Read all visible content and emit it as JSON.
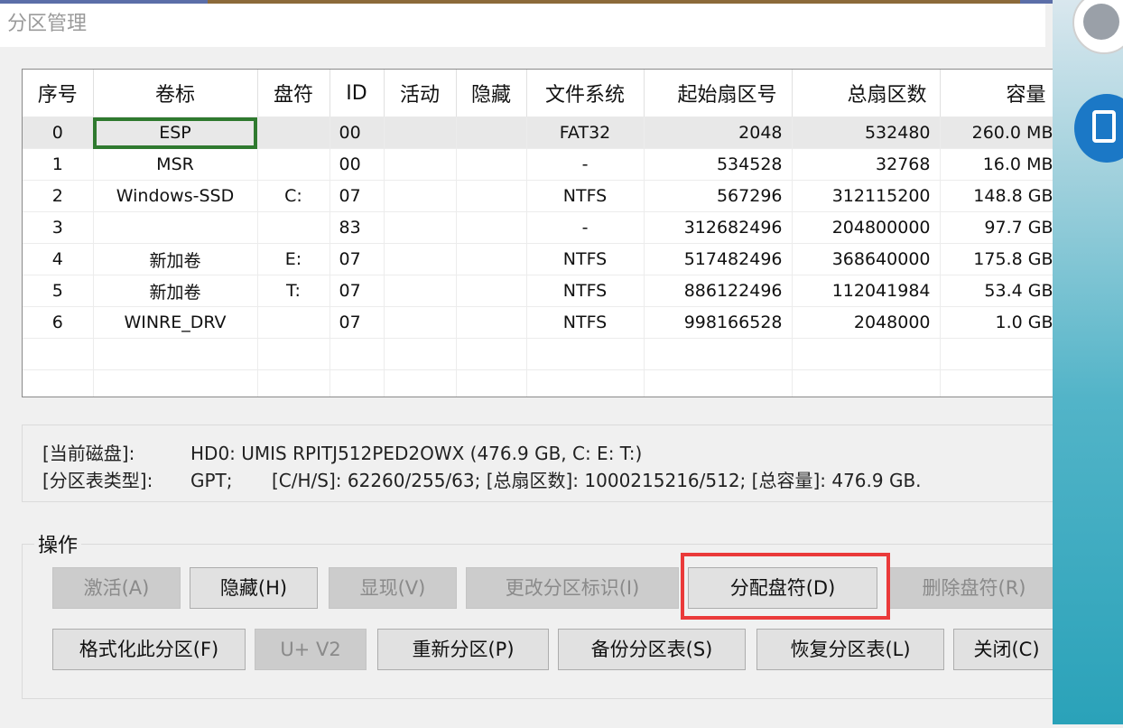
{
  "window": {
    "title": "分区管理"
  },
  "table": {
    "headers": [
      "序号",
      "卷标",
      "盘符",
      "ID",
      "活动",
      "隐藏",
      "文件系统",
      "起始扇区号",
      "总扇区数",
      "容量"
    ],
    "rows": [
      [
        "0",
        "ESP",
        "",
        "00",
        "",
        "",
        "FAT32",
        "2048",
        "532480",
        "260.0 MB"
      ],
      [
        "1",
        "MSR",
        "",
        "00",
        "",
        "",
        "-",
        "534528",
        "32768",
        "16.0 MB"
      ],
      [
        "2",
        "Windows-SSD",
        "C:",
        "07",
        "",
        "",
        "NTFS",
        "567296",
        "312115200",
        "148.8 GB"
      ],
      [
        "3",
        "",
        "",
        "83",
        "",
        "",
        "-",
        "312682496",
        "204800000",
        "97.7 GB"
      ],
      [
        "4",
        "新加卷",
        "E:",
        "07",
        "",
        "",
        "NTFS",
        "517482496",
        "368640000",
        "175.8 GB"
      ],
      [
        "5",
        "新加卷",
        "T:",
        "07",
        "",
        "",
        "NTFS",
        "886122496",
        "112041984",
        "53.4 GB"
      ],
      [
        "6",
        "WINRE_DRV",
        "",
        "07",
        "",
        "",
        "NTFS",
        "998166528",
        "2048000",
        "1.0 GB"
      ]
    ]
  },
  "info": {
    "disk_label": "[当前磁盘]:",
    "disk_value": "HD0: UMIS RPITJ512PED2OWX (476.9 GB, C: E: T:)",
    "type_label": "[分区表类型]:",
    "type_value": "GPT;",
    "geometry": "[C/H/S]: 62260/255/63; [总扇区数]: 1000215216/512; [总容量]: 476.9 GB."
  },
  "ops": {
    "title": "操作",
    "activate": "激活(A)",
    "hide": "隐藏(H)",
    "show": "显现(V)",
    "change_id": "更改分区标识(I)",
    "assign_letter": "分配盘符(D)",
    "delete_letter": "删除盘符(R)",
    "format": "格式化此分区(F)",
    "uv2": "U+ V2",
    "repartition": "重新分区(P)",
    "backup_table": "备份分区表(S)",
    "restore_table": "恢复分区表(L)",
    "close": "关闭(C)"
  },
  "colors": {
    "highlight_green": "#2f7a2f",
    "highlight_red": "#ea3a3a"
  },
  "icons": [
    "avatar-icon",
    "tablet-icon"
  ]
}
